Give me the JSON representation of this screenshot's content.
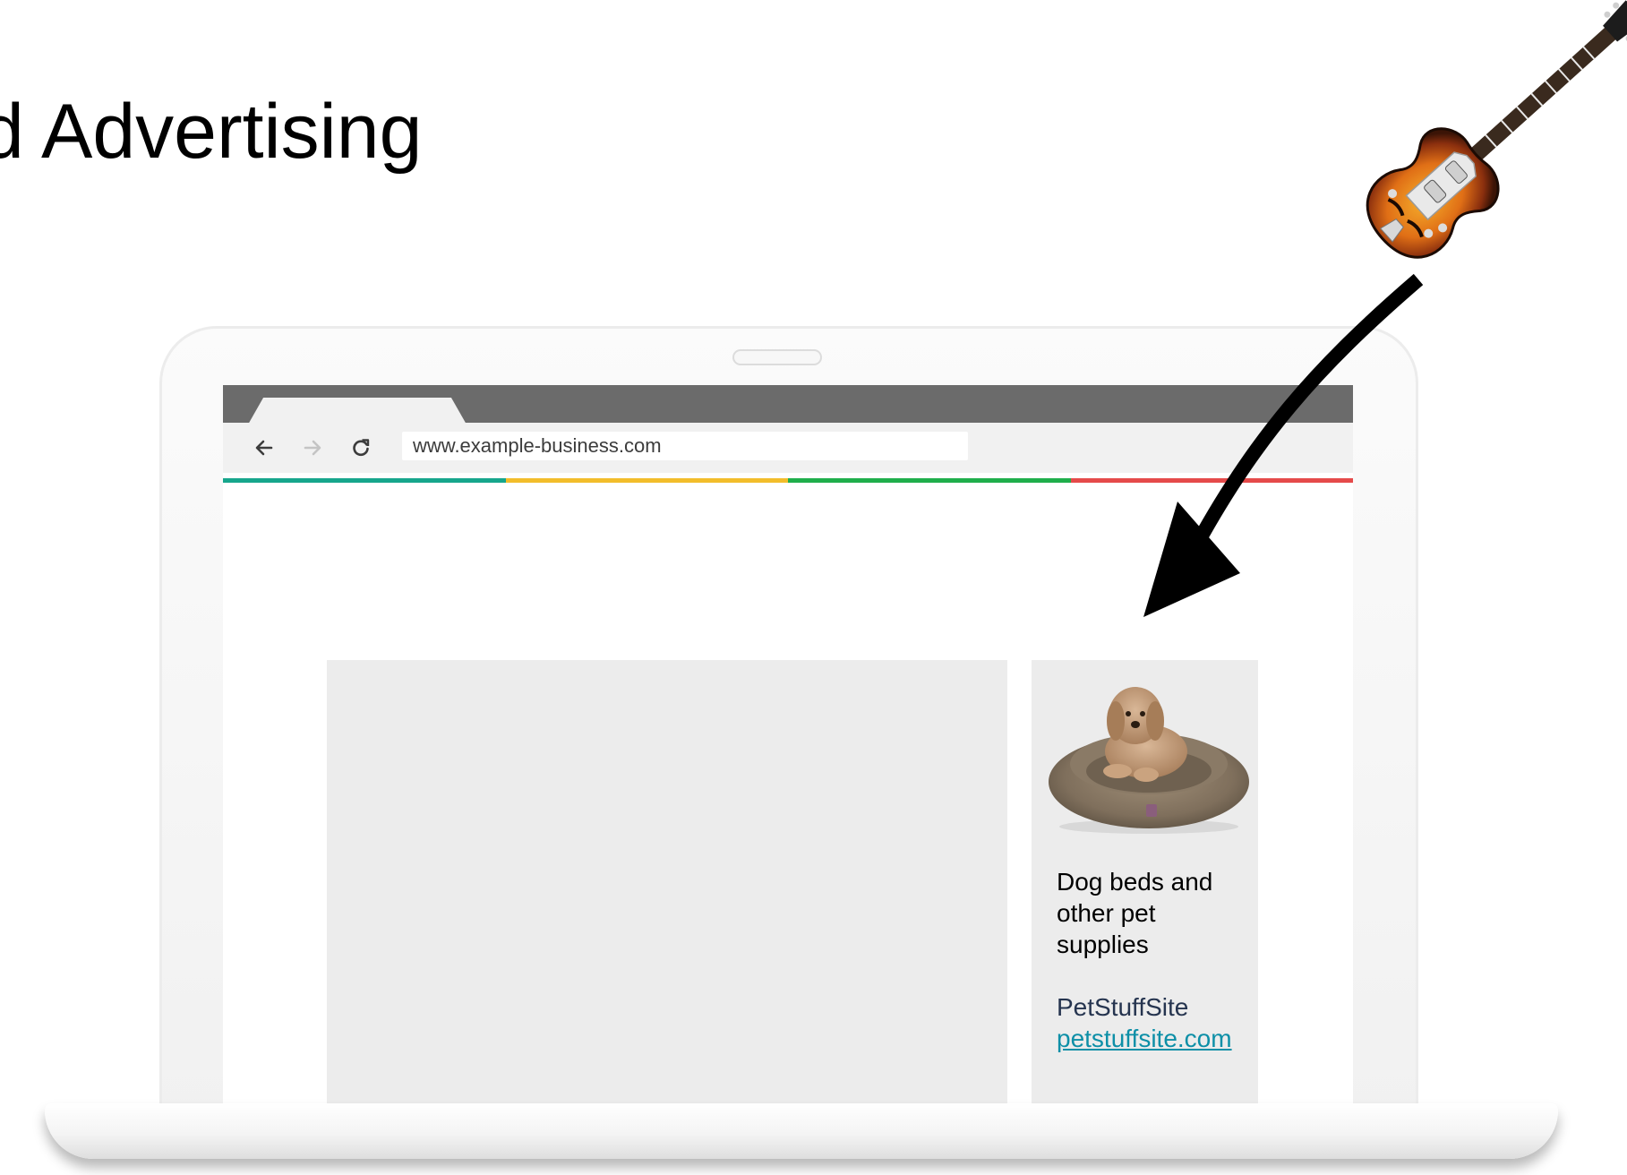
{
  "slide": {
    "title": "d Advertising"
  },
  "browser": {
    "url": "www.example-business.com",
    "stripe_colors": [
      "#17a68c",
      "#f2bd2b",
      "#1fae4b",
      "#e54a4a"
    ]
  },
  "ad": {
    "headline": "Dog beds and other pet supplies",
    "advertiser": "PetStuffSite",
    "url": "petstuffsite.com"
  }
}
